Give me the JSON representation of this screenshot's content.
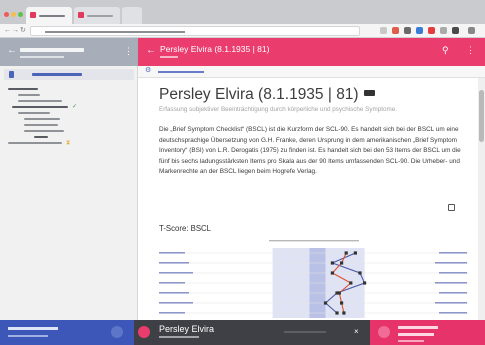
{
  "browser": {
    "tab_count": 3,
    "accent": "#e23a5c"
  },
  "app": {
    "header_title": "Persley Elvira (8.1.1935 | 81)",
    "accent_color": "#ea3d6e",
    "sidebar_accent": "#3c57b8",
    "topbar_icons": [
      "search-icon",
      "more-vert-icon"
    ]
  },
  "sidebar": {
    "header_icon": "arrow-back-icon",
    "selected_icon": "document-icon",
    "pending_icon": "hourglass-icon",
    "check_icon": "check-icon"
  },
  "content": {
    "title": "Persley Elvira (8.1.1935 | 81)",
    "description": "Erfassung subjektiver Beeinträchtigung durch körperliche und psychische Symptome.",
    "paragraph": "Die „Brief Symptom Checklist“ (BSCL) ist die Kurzform der SCL-90. Es handelt sich bei der BSCL um eine deutschsprachige Übersetzung von G.H. Franke, deren Ursprung in dem amerikanischen „Brief Symptom Inventory“ (BSI) von L.R. Derogatis (1975) zu finden ist. Es handelt sich bei den 53 Items der BSCL um die fünf bis sechs ladungsstärksten Items pro Skala aus der 90 Items umfassenden SCL-90. Die Urheber- und Markenrechte an der BSCL liegen beim Hogrefe Verlag.",
    "chart_title": "T-Score: BSCL"
  },
  "bottom_bar": {
    "center_name": "Persley Elvira",
    "close_glyph": "×",
    "left_color": "#3c57b8",
    "right_color": "#e6336a"
  },
  "chart_data": {
    "type": "line",
    "scales_shown": 7,
    "series": [
      {
        "color": "#4a5aa8",
        "values": [
          0.68,
          0.58,
          0.7,
          0.72,
          0.6,
          0.55,
          0.6
        ]
      },
      {
        "color": "#e0502a",
        "values": [
          0.64,
          0.62,
          0.58,
          0.66,
          0.61,
          0.62,
          0.63
        ]
      }
    ],
    "grid": true
  }
}
